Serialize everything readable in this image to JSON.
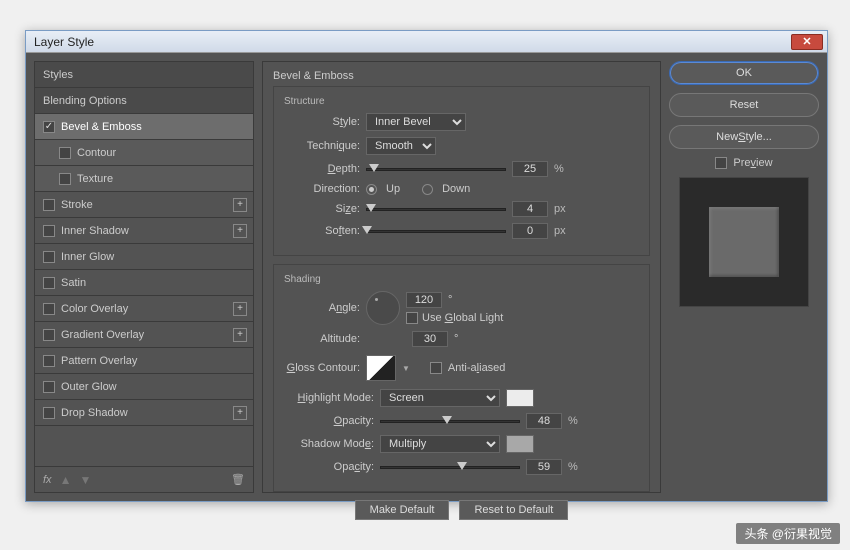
{
  "window": {
    "title": "Layer Style"
  },
  "sidebar": {
    "styles": "Styles",
    "blending": "Blending Options",
    "bevel": "Bevel & Emboss",
    "contour": "Contour",
    "texture": "Texture",
    "stroke": "Stroke",
    "innerShadow": "Inner Shadow",
    "innerGlow": "Inner Glow",
    "satin": "Satin",
    "colorOverlay": "Color Overlay",
    "gradientOverlay": "Gradient Overlay",
    "patternOverlay": "Pattern Overlay",
    "outerGlow": "Outer Glow",
    "dropShadow": "Drop Shadow",
    "fx": "fx"
  },
  "main": {
    "title": "Bevel & Emboss",
    "structure": {
      "legend": "Structure",
      "styleLabel": "Style:",
      "styleValue": "Inner Bevel",
      "techniqueLabel": "Technique:",
      "techniqueValue": "Smooth",
      "depthLabel": "Depth:",
      "depthValue": "25",
      "depthUnit": "%",
      "directionLabel": "Direction:",
      "upLabel": "Up",
      "downLabel": "Down",
      "sizeLabel": "Size:",
      "sizeValue": "4",
      "sizeUnit": "px",
      "softenLabel": "Soften:",
      "softenValue": "0",
      "softenUnit": "px"
    },
    "shading": {
      "legend": "Shading",
      "angleLabel": "Angle:",
      "angleValue": "120",
      "angleUnit": "°",
      "globalLight": "Use Global Light",
      "altitudeLabel": "Altitude:",
      "altitudeValue": "30",
      "altitudeUnit": "°",
      "glossLabel": "Gloss Contour:",
      "antiAliased": "Anti-aliased",
      "highlightLabel": "Highlight Mode:",
      "highlightValue": "Screen",
      "highlightColor": "#ececec",
      "hOpacityLabel": "Opacity:",
      "hOpacityValue": "48",
      "hOpacityUnit": "%",
      "shadowLabel": "Shadow Mode:",
      "shadowValue": "Multiply",
      "shadowColor": "#a8a8a8",
      "sOpacityLabel": "Opacity:",
      "sOpacityValue": "59",
      "sOpacityUnit": "%"
    },
    "makeDefault": "Make Default",
    "resetDefault": "Reset to Default"
  },
  "right": {
    "ok": "OK",
    "reset": "Reset",
    "newStyle": "New Style...",
    "preview": "Preview"
  },
  "watermark": "头条 @衍果视觉"
}
